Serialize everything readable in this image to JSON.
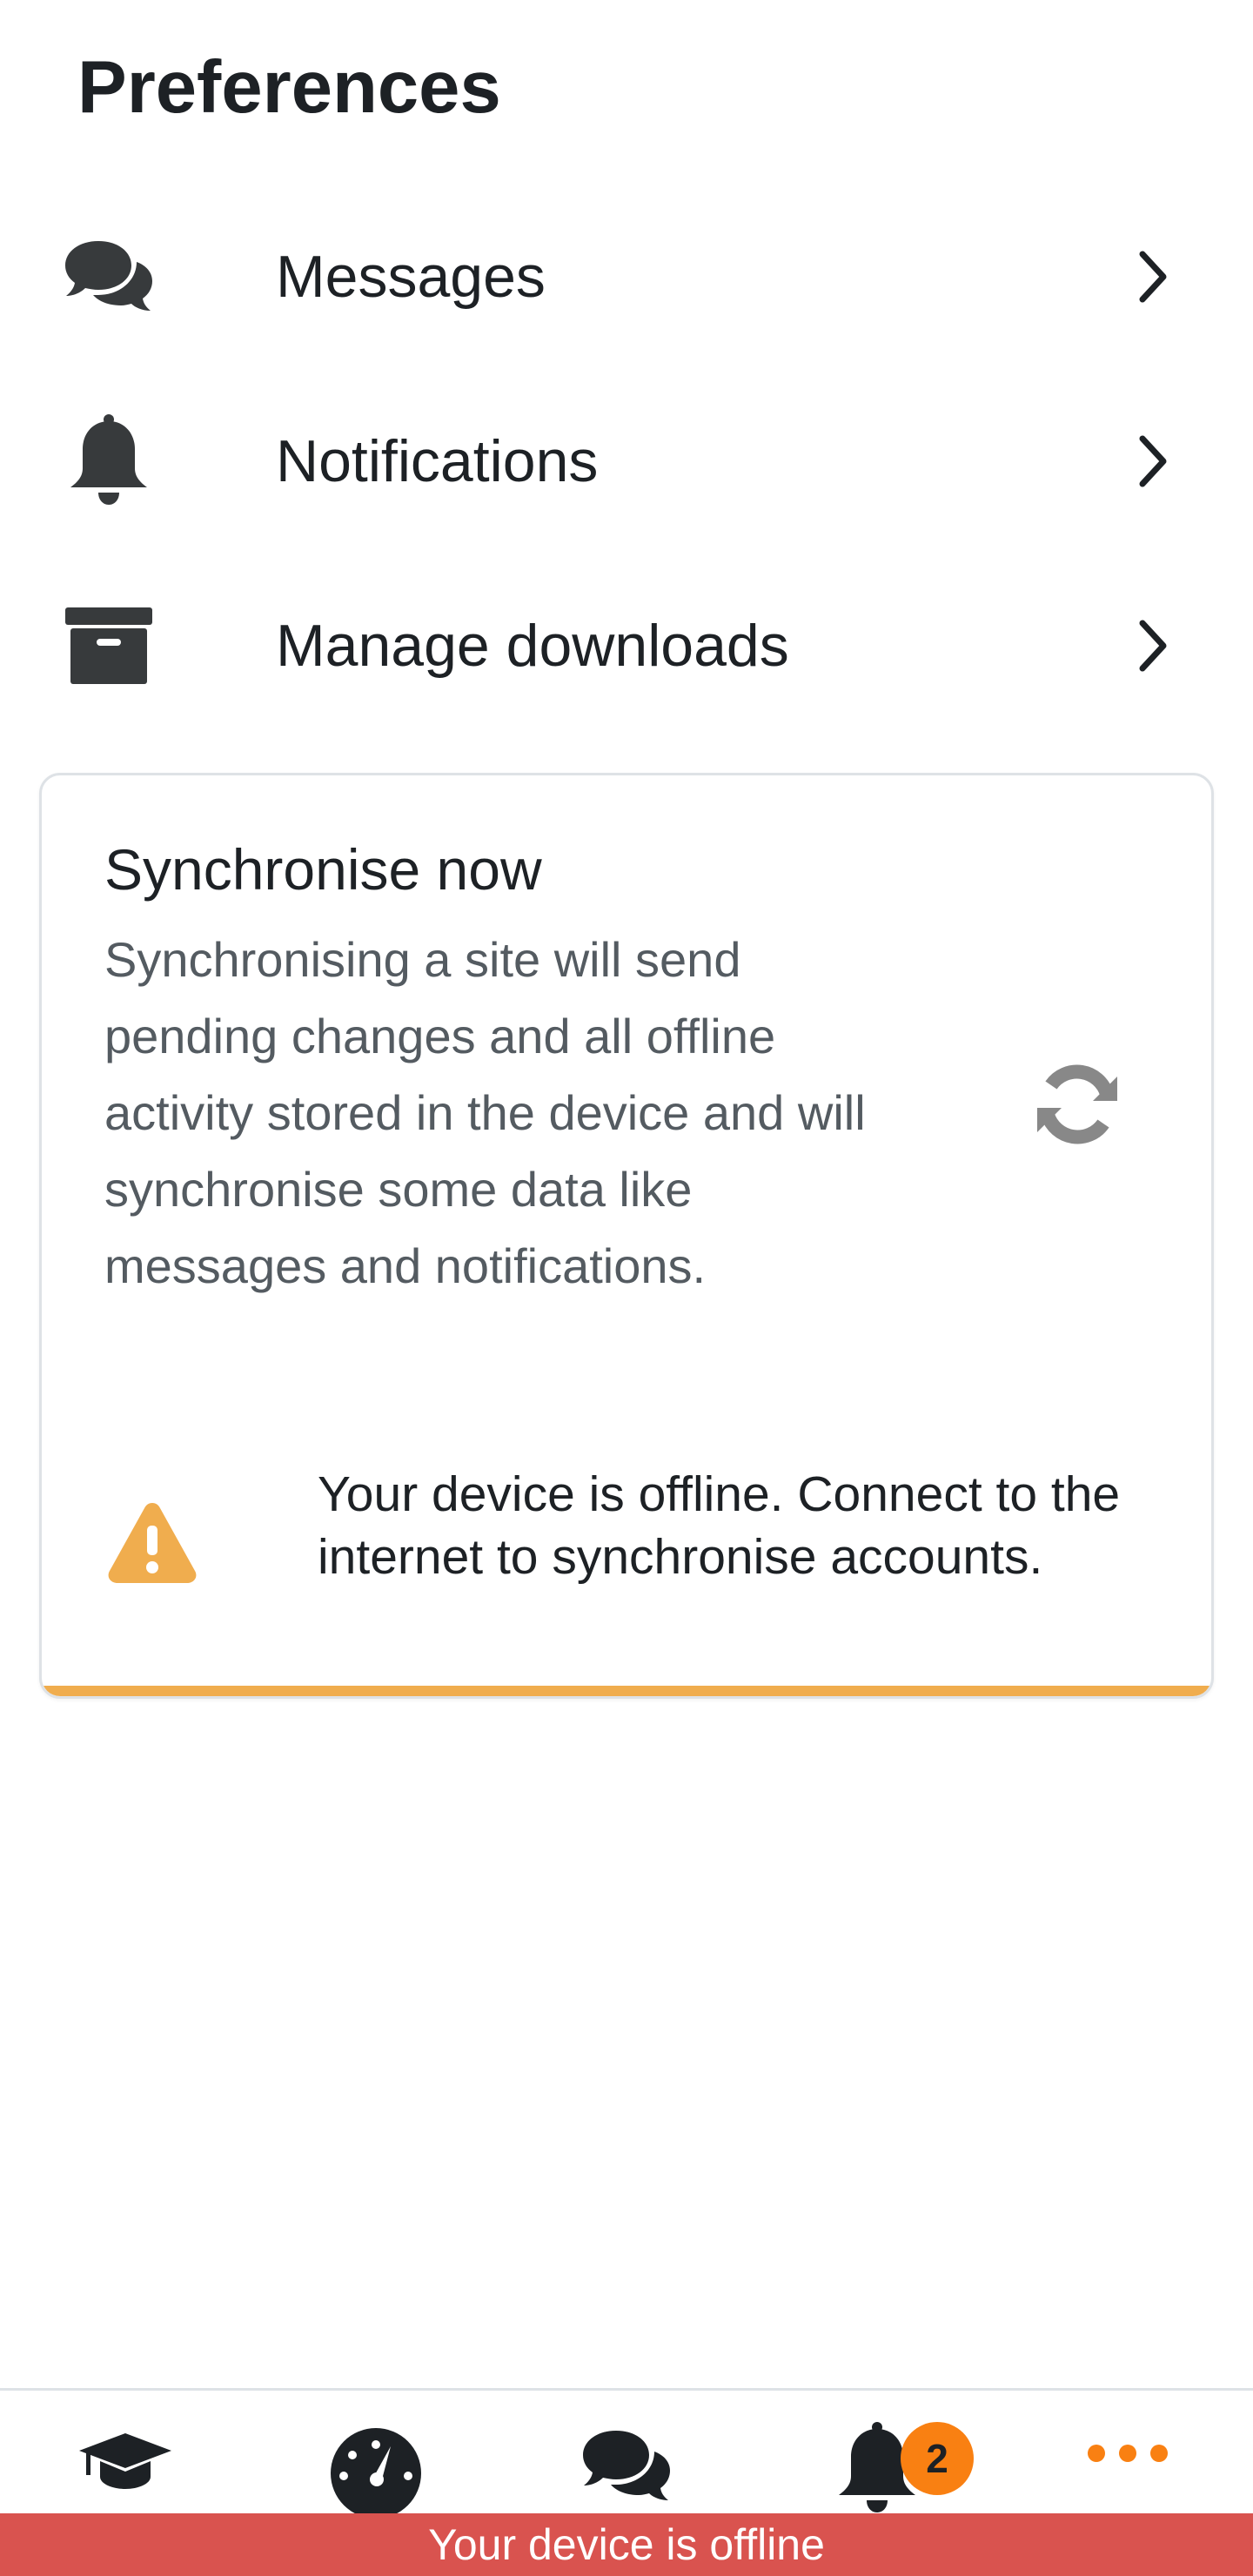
{
  "header": {
    "title": "Preferences"
  },
  "preferences": [
    {
      "label": "Messages",
      "icon": "comments-icon"
    },
    {
      "label": "Notifications",
      "icon": "bell-icon"
    },
    {
      "label": "Manage downloads",
      "icon": "archive-icon"
    }
  ],
  "sync": {
    "title": "Synchronise now",
    "description": "Synchronising a site will send pending changes and all offline activity stored in the device and will synchronise some data like messages and notifications.",
    "warning": "Your device is offline. Connect to the internet to synchronise accounts.",
    "button_icon": "sync-icon"
  },
  "tabs": [
    {
      "name": "courses",
      "icon": "graduation-cap-icon"
    },
    {
      "name": "dashboard",
      "icon": "gauge-icon"
    },
    {
      "name": "messages",
      "icon": "comments-icon"
    },
    {
      "name": "notifications",
      "icon": "bell-icon",
      "badge": "2"
    },
    {
      "name": "more",
      "icon": "ellipsis-icon"
    }
  ],
  "status": {
    "offline_message": "Your device is offline"
  },
  "colors": {
    "accent": "#f98012",
    "warning": "#f0ad4e",
    "offline": "#d9534f",
    "icon": "#373a3c"
  }
}
